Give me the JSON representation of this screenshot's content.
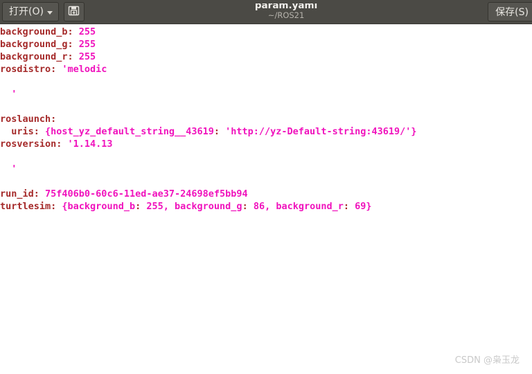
{
  "window": {
    "title": "param.yaml",
    "subtitle": "~/ROS21"
  },
  "toolbar": {
    "open_label": "打开(O)",
    "open_icon": "chevron-down-icon",
    "save_as_icon": "save-as-document-icon",
    "save_label": "保存(S)"
  },
  "editor": {
    "language": "yaml",
    "lines": [
      {
        "id": 1,
        "segments": [
          {
            "cls": "k",
            "text": "background_b:"
          },
          {
            "cls": "v",
            "text": " 255"
          }
        ]
      },
      {
        "id": 2,
        "segments": [
          {
            "cls": "k",
            "text": "background_g:"
          },
          {
            "cls": "v",
            "text": " 255"
          }
        ]
      },
      {
        "id": 3,
        "segments": [
          {
            "cls": "k",
            "text": "background_r:"
          },
          {
            "cls": "v",
            "text": " 255"
          }
        ]
      },
      {
        "id": 4,
        "segments": [
          {
            "cls": "k",
            "text": "rosdistro:"
          },
          {
            "cls": "v",
            "text": " 'melodic"
          }
        ]
      },
      {
        "id": 5,
        "segments": [
          {
            "cls": "k",
            "text": ""
          }
        ]
      },
      {
        "id": 6,
        "segments": [
          {
            "cls": "v",
            "text": "  '"
          }
        ]
      },
      {
        "id": 7,
        "segments": [
          {
            "cls": "k",
            "text": ""
          }
        ]
      },
      {
        "id": 8,
        "segments": [
          {
            "cls": "k",
            "text": "roslaunch:"
          }
        ]
      },
      {
        "id": 9,
        "segments": [
          {
            "cls": "k",
            "text": "  uris:"
          },
          {
            "cls": "v",
            "text": " {"
          },
          {
            "cls": "v",
            "text": "host_yz_default_string__43619"
          },
          {
            "cls": "k",
            "text": ":"
          },
          {
            "cls": "v",
            "text": " 'http://yz-Default-string:43619/'}"
          }
        ]
      },
      {
        "id": 10,
        "segments": [
          {
            "cls": "k",
            "text": "rosversion:"
          },
          {
            "cls": "v",
            "text": " '1.14.13"
          }
        ]
      },
      {
        "id": 11,
        "segments": [
          {
            "cls": "k",
            "text": ""
          }
        ]
      },
      {
        "id": 12,
        "segments": [
          {
            "cls": "v",
            "text": "  '"
          }
        ]
      },
      {
        "id": 13,
        "segments": [
          {
            "cls": "k",
            "text": ""
          }
        ]
      },
      {
        "id": 14,
        "segments": [
          {
            "cls": "k",
            "text": "run_id:"
          },
          {
            "cls": "v",
            "text": " 75f406b0-60c6-11ed-ae37-24698ef5bb94"
          }
        ]
      },
      {
        "id": 15,
        "segments": [
          {
            "cls": "k",
            "text": "turtlesim:"
          },
          {
            "cls": "v",
            "text": " {"
          },
          {
            "cls": "v",
            "text": "background_b"
          },
          {
            "cls": "k",
            "text": ":"
          },
          {
            "cls": "v",
            "text": " 255, "
          },
          {
            "cls": "v",
            "text": "background_g"
          },
          {
            "cls": "k",
            "text": ":"
          },
          {
            "cls": "v",
            "text": " 86, "
          },
          {
            "cls": "v",
            "text": "background_r"
          },
          {
            "cls": "k",
            "text": ":"
          },
          {
            "cls": "v",
            "text": " 69}"
          }
        ]
      }
    ]
  },
  "watermark": {
    "text": "CSDN @枭玉龙"
  },
  "colors": {
    "titlebar_bg": "#4b4a45",
    "button_bg": "#565550",
    "editor_bg": "#ffffff",
    "yaml_key": "#a52a2a",
    "yaml_value": "#f013bd",
    "watermark": "#c9c9c9"
  }
}
